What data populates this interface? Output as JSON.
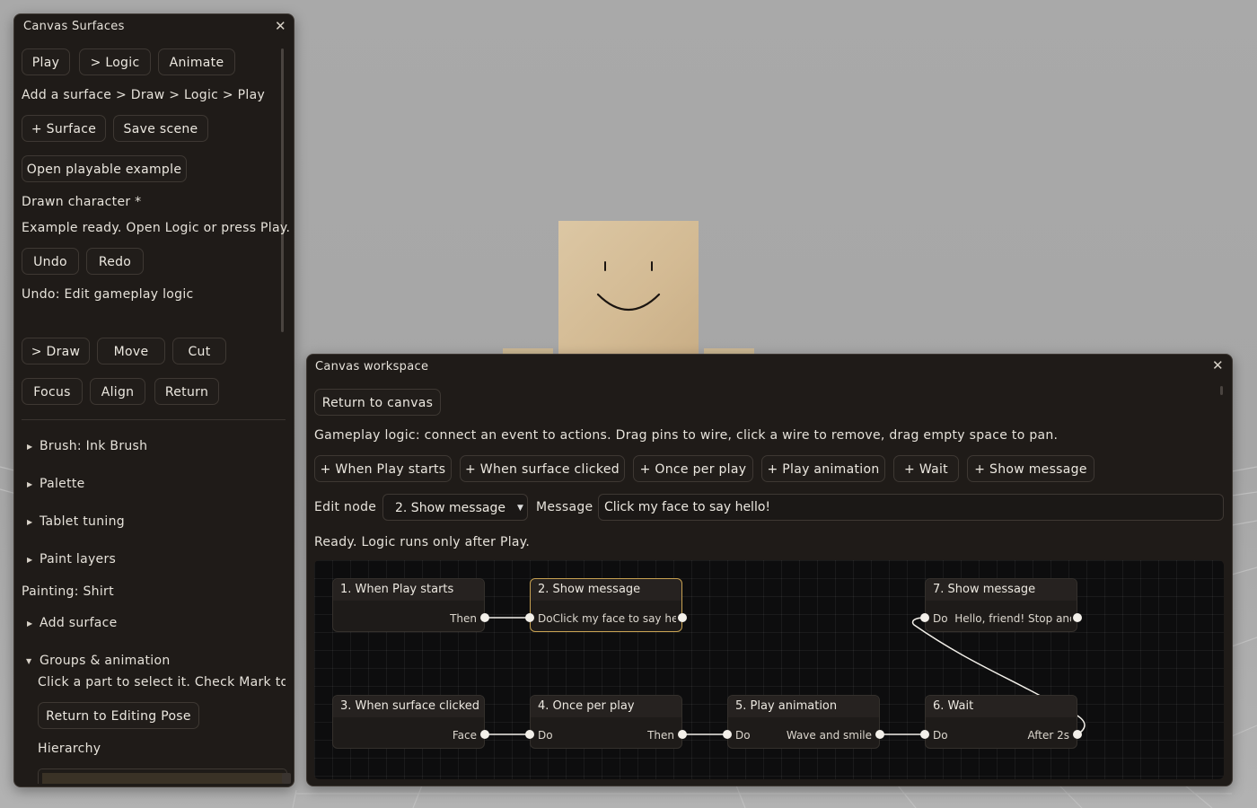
{
  "left_panel": {
    "title": "Canvas Surfaces",
    "top_buttons": [
      "Play",
      "> Logic",
      "Animate"
    ],
    "breadcrumb": "Add a surface > Draw > Logic > Play",
    "add_surface": "+ Surface",
    "save_scene": "Save scene",
    "open_example": "Open playable example",
    "drawn_character": "Drawn character *",
    "status": "Example ready. Open Logic or press Play.",
    "undo": "Undo",
    "redo": "Redo",
    "undo_status": "Undo: Edit gameplay logic",
    "tools": [
      "> Draw",
      "Move",
      "Cut"
    ],
    "tools2": [
      "Focus",
      "Align",
      "Return"
    ],
    "sections": [
      "Brush: Ink Brush",
      "Palette",
      "Tablet tuning",
      "Paint layers"
    ],
    "painting": "Painting: Shirt",
    "add_surface_section": "Add surface",
    "groups_section": "Groups & animation",
    "groups_hint": "Click a part to select it. Check Mark to bu",
    "return_editing": "Return to Editing Pose",
    "hierarchy": "Hierarchy"
  },
  "workspace": {
    "title": "Canvas workspace",
    "return_canvas": "Return to canvas",
    "description": "Gameplay logic: connect an event to actions. Drag pins to wire, click a wire to remove, drag empty space to pan.",
    "add_buttons": [
      "+ When Play starts",
      "+ When surface clicked",
      "+ Once per play",
      "+ Play animation",
      "+ Wait",
      "+ Show message"
    ],
    "edit_node_label": "Edit node",
    "edit_node_value": "2. Show message",
    "message_label": "Message",
    "message_value": "Click my face to say hello!",
    "ready_status": "Ready. Logic runs only after Play.",
    "nodes": [
      {
        "title": "1. When Play starts",
        "left": "",
        "right": "Then"
      },
      {
        "title": "2. Show message",
        "left": "DoClick my face to say hel",
        "right": ""
      },
      {
        "title": "7. Show message",
        "left": "Do  Hello, friend! Stop and",
        "right": ""
      },
      {
        "title": "3. When surface clicked",
        "left": "",
        "right": "Face"
      },
      {
        "title": "4. Once per play",
        "left": "Do",
        "right": "Then"
      },
      {
        "title": "5. Play animation",
        "left": "Do",
        "right": "Wave and smile"
      },
      {
        "title": "6. Wait",
        "left": "Do",
        "right": "After 2s"
      }
    ]
  },
  "colors": {
    "panel_bg": "#1f1b18",
    "selected_node_border": "#c7a152",
    "graph_bg": "#0d0d0e",
    "character_face": "#d8c29e",
    "shirt": "#2e6f7a"
  }
}
